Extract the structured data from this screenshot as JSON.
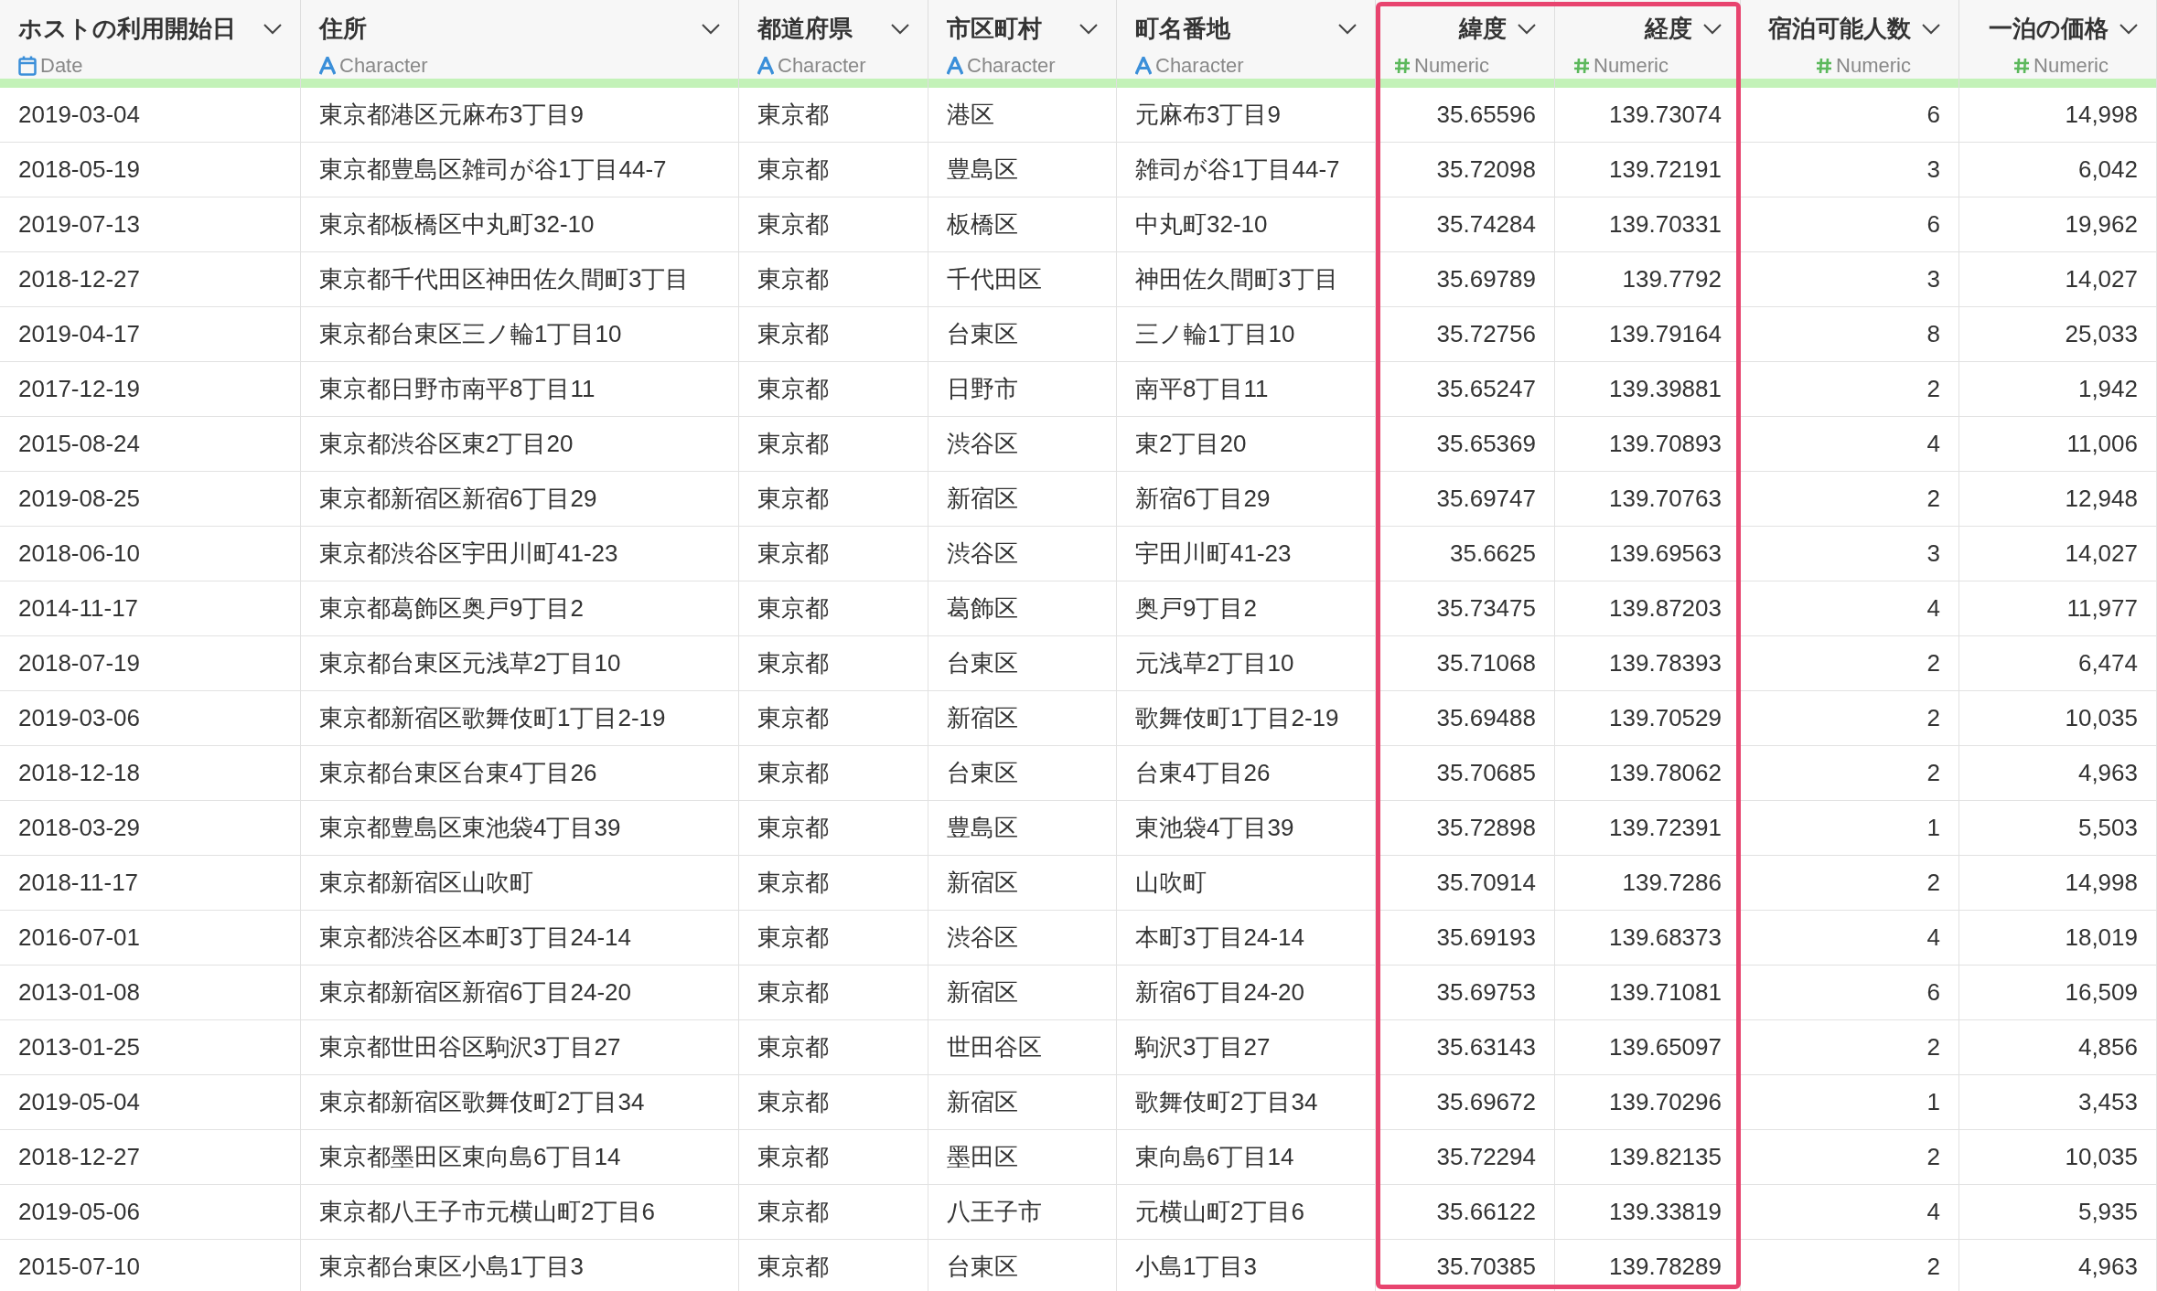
{
  "columns": [
    {
      "title": "ホストの利用開始日",
      "type": "Date",
      "kind": "date",
      "highlighted": false
    },
    {
      "title": "住所",
      "type": "Character",
      "kind": "character",
      "highlighted": false
    },
    {
      "title": "都道府県",
      "type": "Character",
      "kind": "character",
      "highlighted": false
    },
    {
      "title": "市区町村",
      "type": "Character",
      "kind": "character",
      "highlighted": false
    },
    {
      "title": "町名番地",
      "type": "Character",
      "kind": "character",
      "highlighted": false
    },
    {
      "title": "緯度",
      "type": "Numeric",
      "kind": "numeric",
      "highlighted": true
    },
    {
      "title": "経度",
      "type": "Numeric",
      "kind": "numeric",
      "highlighted": true
    },
    {
      "title": "宿泊可能人数",
      "type": "Numeric",
      "kind": "numeric",
      "highlighted": false
    },
    {
      "title": "一泊の価格",
      "type": "Numeric",
      "kind": "numeric",
      "highlighted": false
    }
  ],
  "rows": [
    [
      "2019-03-04",
      "東京都港区元麻布3丁目9",
      "東京都",
      "港区",
      "元麻布3丁目9",
      "35.65596",
      "139.73074",
      "6",
      "14,998"
    ],
    [
      "2018-05-19",
      "東京都豊島区雑司が谷1丁目44-7",
      "東京都",
      "豊島区",
      "雑司が谷1丁目44-7",
      "35.72098",
      "139.72191",
      "3",
      "6,042"
    ],
    [
      "2019-07-13",
      "東京都板橋区中丸町32-10",
      "東京都",
      "板橋区",
      "中丸町32-10",
      "35.74284",
      "139.70331",
      "6",
      "19,962"
    ],
    [
      "2018-12-27",
      "東京都千代田区神田佐久間町3丁目",
      "東京都",
      "千代田区",
      "神田佐久間町3丁目",
      "35.69789",
      "139.7792",
      "3",
      "14,027"
    ],
    [
      "2019-04-17",
      "東京都台東区三ノ輪1丁目10",
      "東京都",
      "台東区",
      "三ノ輪1丁目10",
      "35.72756",
      "139.79164",
      "8",
      "25,033"
    ],
    [
      "2017-12-19",
      "東京都日野市南平8丁目11",
      "東京都",
      "日野市",
      "南平8丁目11",
      "35.65247",
      "139.39881",
      "2",
      "1,942"
    ],
    [
      "2015-08-24",
      "東京都渋谷区東2丁目20",
      "東京都",
      "渋谷区",
      "東2丁目20",
      "35.65369",
      "139.70893",
      "4",
      "11,006"
    ],
    [
      "2019-08-25",
      "東京都新宿区新宿6丁目29",
      "東京都",
      "新宿区",
      "新宿6丁目29",
      "35.69747",
      "139.70763",
      "2",
      "12,948"
    ],
    [
      "2018-06-10",
      "東京都渋谷区宇田川町41-23",
      "東京都",
      "渋谷区",
      "宇田川町41-23",
      "35.6625",
      "139.69563",
      "3",
      "14,027"
    ],
    [
      "2014-11-17",
      "東京都葛飾区奥戸9丁目2",
      "東京都",
      "葛飾区",
      "奥戸9丁目2",
      "35.73475",
      "139.87203",
      "4",
      "11,977"
    ],
    [
      "2018-07-19",
      "東京都台東区元浅草2丁目10",
      "東京都",
      "台東区",
      "元浅草2丁目10",
      "35.71068",
      "139.78393",
      "2",
      "6,474"
    ],
    [
      "2019-03-06",
      "東京都新宿区歌舞伎町1丁目2-19",
      "東京都",
      "新宿区",
      "歌舞伎町1丁目2-19",
      "35.69488",
      "139.70529",
      "2",
      "10,035"
    ],
    [
      "2018-12-18",
      "東京都台東区台東4丁目26",
      "東京都",
      "台東区",
      "台東4丁目26",
      "35.70685",
      "139.78062",
      "2",
      "4,963"
    ],
    [
      "2018-03-29",
      "東京都豊島区東池袋4丁目39",
      "東京都",
      "豊島区",
      "東池袋4丁目39",
      "35.72898",
      "139.72391",
      "1",
      "5,503"
    ],
    [
      "2018-11-17",
      "東京都新宿区山吹町",
      "東京都",
      "新宿区",
      "山吹町",
      "35.70914",
      "139.7286",
      "2",
      "14,998"
    ],
    [
      "2016-07-01",
      "東京都渋谷区本町3丁目24-14",
      "東京都",
      "渋谷区",
      "本町3丁目24-14",
      "35.69193",
      "139.68373",
      "4",
      "18,019"
    ],
    [
      "2013-01-08",
      "東京都新宿区新宿6丁目24-20",
      "東京都",
      "新宿区",
      "新宿6丁目24-20",
      "35.69753",
      "139.71081",
      "6",
      "16,509"
    ],
    [
      "2013-01-25",
      "東京都世田谷区駒沢3丁目27",
      "東京都",
      "世田谷区",
      "駒沢3丁目27",
      "35.63143",
      "139.65097",
      "2",
      "4,856"
    ],
    [
      "2019-05-04",
      "東京都新宿区歌舞伎町2丁目34",
      "東京都",
      "新宿区",
      "歌舞伎町2丁目34",
      "35.69672",
      "139.70296",
      "1",
      "3,453"
    ],
    [
      "2018-12-27",
      "東京都墨田区東向島6丁目14",
      "東京都",
      "墨田区",
      "東向島6丁目14",
      "35.72294",
      "139.82135",
      "2",
      "10,035"
    ],
    [
      "2019-05-06",
      "東京都八王子市元横山町2丁目6",
      "東京都",
      "八王子市",
      "元横山町2丁目6",
      "35.66122",
      "139.33819",
      "4",
      "5,935"
    ],
    [
      "2015-07-10",
      "東京都台東区小島1丁目3",
      "東京都",
      "台東区",
      "小島1丁目3",
      "35.70385",
      "139.78289",
      "2",
      "4,963"
    ]
  ]
}
